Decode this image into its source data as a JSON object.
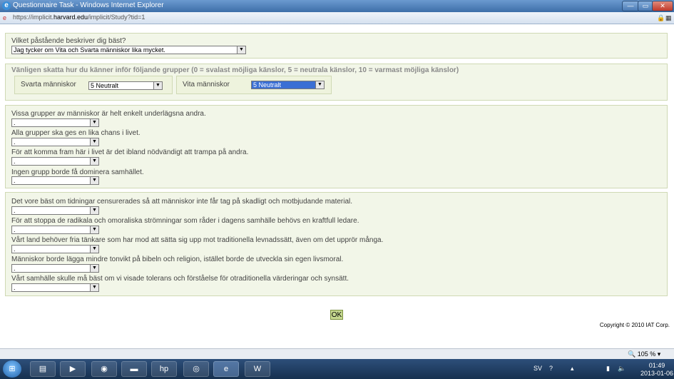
{
  "window": {
    "title": "Questionnaire Task - Windows Internet Explorer",
    "url_prefix": "https://implicit.",
    "url_domain": "harvard.edu",
    "url_path": "/implicit/Study?tid=1"
  },
  "form": {
    "q_top": {
      "label": "Vilket påstående beskriver dig bäst?",
      "value": "Jag tycker om Vita och Svarta människor lika mycket."
    },
    "feelings": {
      "heading": "Vänligen skatta hur du känner inför följande grupper (0 = svalast möjliga känslor, 5 = neutrala känslor, 10 = varmast möjliga känslor)",
      "black_label": "Svarta människor",
      "black_value": "5 Neutralt",
      "white_label": "Vita människor",
      "white_value": "5 Neutralt"
    },
    "group1": [
      {
        "label": "Vissa grupper av människor är helt enkelt underlägsna andra.",
        "value": "."
      },
      {
        "label": "Alla grupper ska ges en lika chans i livet.",
        "value": "."
      },
      {
        "label": "För att komma fram här i livet är det ibland nödvändigt att trampa på andra.",
        "value": "."
      },
      {
        "label": "Ingen grupp borde få dominera samhället.",
        "value": "."
      }
    ],
    "group2": [
      {
        "label": "Det vore bäst om tidningar censurerades så att människor inte får tag på skadligt och motbjudande material.",
        "value": "."
      },
      {
        "label": "För att stoppa de radikala och omoraliska strömningar som råder i dagens samhälle behövs en kraftfull ledare.",
        "value": "."
      },
      {
        "label": "Vårt land behöver fria tänkare som har mod att sätta sig upp mot traditionella levnadssätt, även om det upprör många.",
        "value": "."
      },
      {
        "label": "Människor borde lägga mindre tonvikt på bibeln och religion, istället borde de utveckla sin egen livsmoral.",
        "value": "."
      },
      {
        "label": "Vårt samhälle skulle må bäst om vi visade tolerans och förståelse för otraditionella värderingar och synsätt.",
        "value": "."
      }
    ],
    "ok_label": "OK",
    "copyright": "Copyright © 2010 IAT Corp."
  },
  "statusbar": {
    "zoom": "105 %"
  },
  "taskbar": {
    "lang": "SV",
    "time": "01:49",
    "date": "2013-01-06"
  },
  "icons": {
    "arrow": "▼",
    "ie": "e",
    "word": "W"
  }
}
